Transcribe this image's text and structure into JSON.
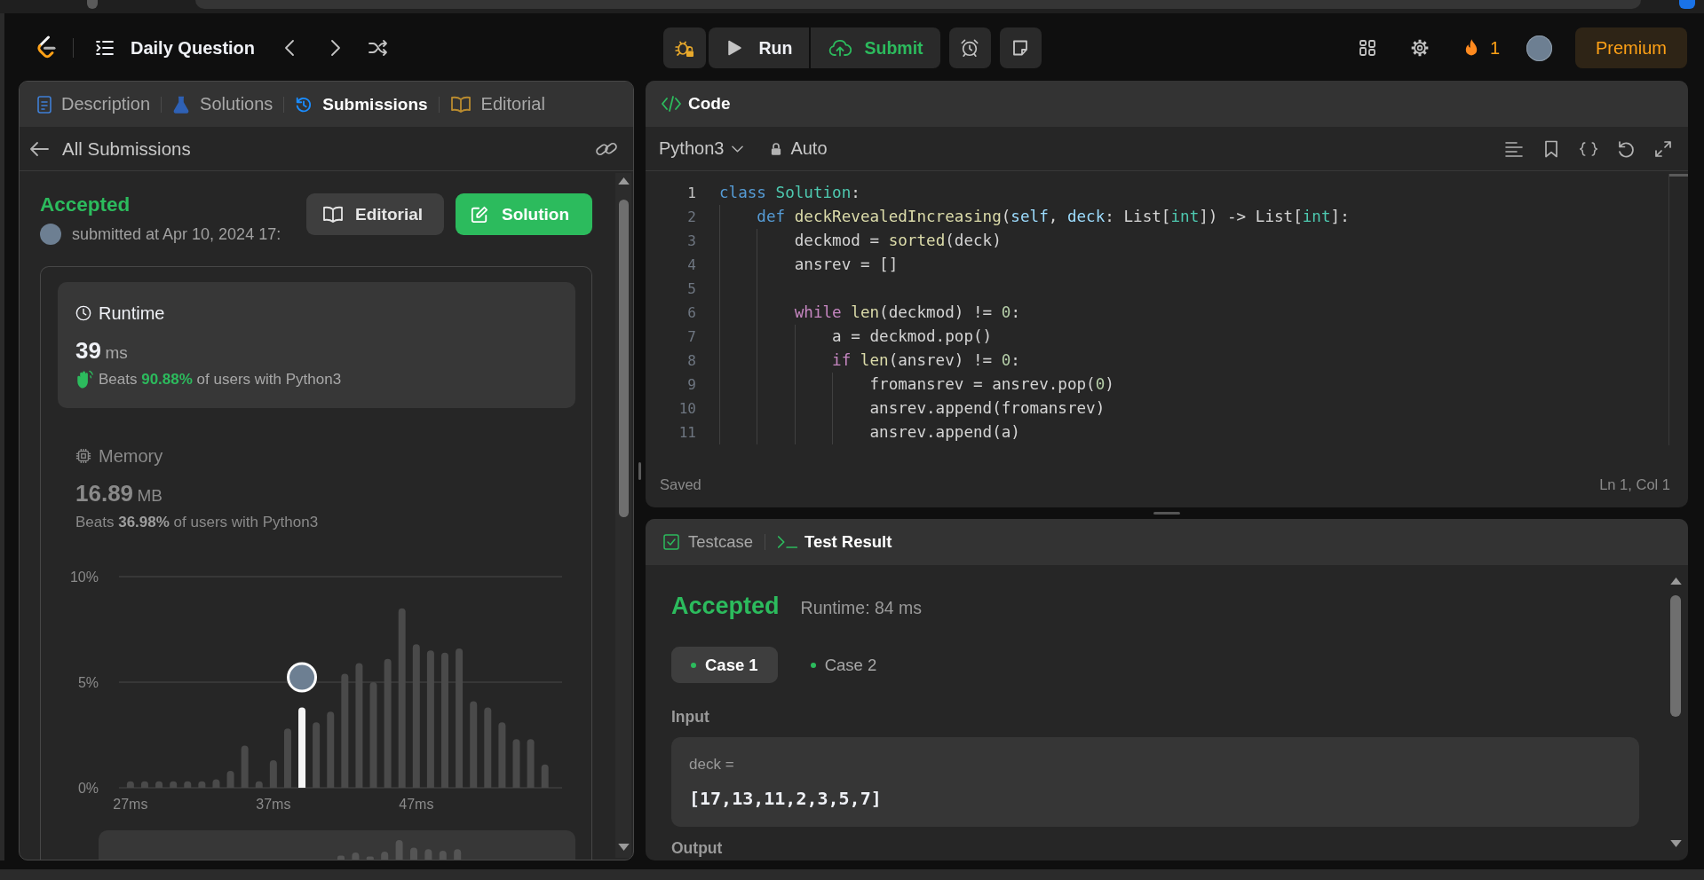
{
  "nav": {
    "title": "Daily Question",
    "run": "Run",
    "submit": "Submit",
    "streak": "1",
    "premium": "Premium"
  },
  "left_panel": {
    "tabs": [
      {
        "label": "Description",
        "kind": "description",
        "selected": false
      },
      {
        "label": "Solutions",
        "kind": "solutions",
        "selected": false
      },
      {
        "label": "Submissions",
        "kind": "submissions",
        "selected": true
      },
      {
        "label": "Editorial",
        "kind": "editorial",
        "selected": false
      }
    ],
    "back": "All Submissions",
    "submission": {
      "status": "Accepted",
      "submitted": "submitted at Apr 10, 2024 17:",
      "buttons": [
        {
          "label": "Editorial",
          "kind": "editorial"
        },
        {
          "label": "Solution",
          "kind": "solution"
        }
      ]
    },
    "stats": [
      {
        "kind": "runtime",
        "label": "Runtime",
        "value": "39",
        "unit": "ms",
        "beats": "Beats **90.88%** of users with Python3",
        "selected": true
      },
      {
        "kind": "memory",
        "label": "Memory",
        "value": "16.89",
        "unit": "MB",
        "beats": "Beats **36.98%** of users with Python3",
        "selected": false
      }
    ],
    "chart_data": {
      "type": "bar",
      "stacked": true,
      "x": [
        27,
        28,
        29,
        30,
        31,
        32,
        33,
        34,
        35,
        36,
        37,
        38,
        39,
        40,
        41,
        42,
        43,
        44,
        45,
        46,
        47,
        48,
        49,
        50,
        51,
        52,
        53,
        54,
        55,
        56
      ],
      "xlim": [
        26.2,
        57.2
      ],
      "series": [
        {
          "color": "#4a4a4a",
          "values": [
            0.3,
            0.3,
            0.3,
            0.3,
            0.3,
            0.3,
            0.4,
            0.8,
            2.0,
            0.3,
            1.3,
            2.8,
            null,
            3.1,
            3.6,
            5.4,
            5.9,
            5.0,
            6.1,
            8.5,
            6.8,
            6.5,
            6.4,
            6.6,
            4.1,
            3.8,
            3.1,
            2.3,
            2.3,
            1.1
          ]
        },
        {
          "color": "#f5f5f5",
          "values": [
            null,
            null,
            null,
            null,
            null,
            null,
            null,
            null,
            null,
            null,
            null,
            null,
            3.8,
            null,
            null,
            null,
            null,
            null,
            null,
            null,
            null,
            null,
            null,
            null,
            null,
            null,
            null,
            null,
            null,
            null
          ]
        }
      ],
      "ylim": [
        0,
        10
      ],
      "yticks": [
        {
          "value": 0,
          "label": "0%"
        },
        {
          "value": 5,
          "label": "5%"
        },
        {
          "value": 10,
          "label": "10%"
        }
      ],
      "xticks": [
        {
          "value": 27,
          "label": "27ms"
        },
        {
          "value": 37,
          "label": "37ms"
        },
        {
          "value": 47,
          "label": "47ms"
        }
      ]
    }
  },
  "code_panel": {
    "title": "Code",
    "language": "Python3",
    "mode": "Auto",
    "lines": [
      {
        "number": "1",
        "current": true,
        "tokens": [
          {
            "text": "class",
            "kind": "keyword"
          },
          {
            "text": " Solution",
            "kind": "class-name"
          },
          {
            "text": ":",
            "kind": "plain"
          }
        ]
      },
      {
        "number": "2",
        "current": false,
        "tokens": [
          {
            "text": "    def",
            "kind": "keyword"
          },
          {
            "text": " deckRevealedIncreasing",
            "kind": "function"
          },
          {
            "text": "(",
            "kind": "plain"
          },
          {
            "text": "self",
            "kind": "parameter"
          },
          {
            "text": ", ",
            "kind": "plain"
          },
          {
            "text": "deck",
            "kind": "parameter"
          },
          {
            "text": ": List[",
            "kind": "plain"
          },
          {
            "text": "int",
            "kind": "type"
          },
          {
            "text": "]) -> List[",
            "kind": "plain"
          },
          {
            "text": "int",
            "kind": "type"
          },
          {
            "text": "]:",
            "kind": "plain"
          }
        ]
      },
      {
        "number": "3",
        "current": false,
        "tokens": [
          {
            "text": "        deckmod = ",
            "kind": "plain"
          },
          {
            "text": "sorted",
            "kind": "function"
          },
          {
            "text": "(deck)",
            "kind": "plain"
          }
        ]
      },
      {
        "number": "4",
        "current": false,
        "tokens": [
          {
            "text": "        ansrev = []",
            "kind": "plain"
          }
        ]
      },
      {
        "number": "5",
        "current": false
      },
      {
        "number": "6",
        "current": false,
        "tokens": [
          {
            "text": "        while",
            "kind": "control"
          },
          {
            "text": " len",
            "kind": "function"
          },
          {
            "text": "(deckmod) != ",
            "kind": "plain"
          },
          {
            "text": "0",
            "kind": "number"
          },
          {
            "text": ":",
            "kind": "plain"
          }
        ]
      },
      {
        "number": "7",
        "current": false,
        "tokens": [
          {
            "text": "            a = deckmod.pop()",
            "kind": "plain"
          }
        ]
      },
      {
        "number": "8",
        "current": false,
        "tokens": [
          {
            "text": "            if",
            "kind": "control"
          },
          {
            "text": " len",
            "kind": "function"
          },
          {
            "text": "(ansrev) != ",
            "kind": "plain"
          },
          {
            "text": "0",
            "kind": "number"
          },
          {
            "text": ":",
            "kind": "plain"
          }
        ]
      },
      {
        "number": "9",
        "current": false,
        "tokens": [
          {
            "text": "                fromansrev = ansrev.pop(",
            "kind": "plain"
          },
          {
            "text": "0",
            "kind": "number"
          },
          {
            "text": ")",
            "kind": "plain"
          }
        ]
      },
      {
        "number": "10",
        "current": false,
        "tokens": [
          {
            "text": "                ansrev.append(fromansrev)",
            "kind": "plain"
          }
        ]
      },
      {
        "number": "11",
        "current": false,
        "tokens": [
          {
            "text": "                ansrev.append(a)",
            "kind": "plain"
          }
        ]
      }
    ],
    "status": "Saved",
    "cursor": "Ln 1, Col 1"
  },
  "test_panel": {
    "tabs": [
      {
        "label": "Testcase",
        "kind": "testcase",
        "selected": false
      },
      {
        "label": "Test Result",
        "kind": "result",
        "selected": true
      }
    ],
    "status": "Accepted",
    "runtime": "Runtime: 84 ms",
    "cases": [
      {
        "label": "Case 1",
        "selected": true,
        "passed": true
      },
      {
        "label": "Case 2",
        "selected": false,
        "passed": true
      }
    ],
    "sections": [
      {
        "label": "Input",
        "params": [
          {
            "name": "deck =",
            "value": "[17,13,11,2,3,5,7]"
          }
        ]
      },
      {
        "label": "Output"
      }
    ]
  }
}
